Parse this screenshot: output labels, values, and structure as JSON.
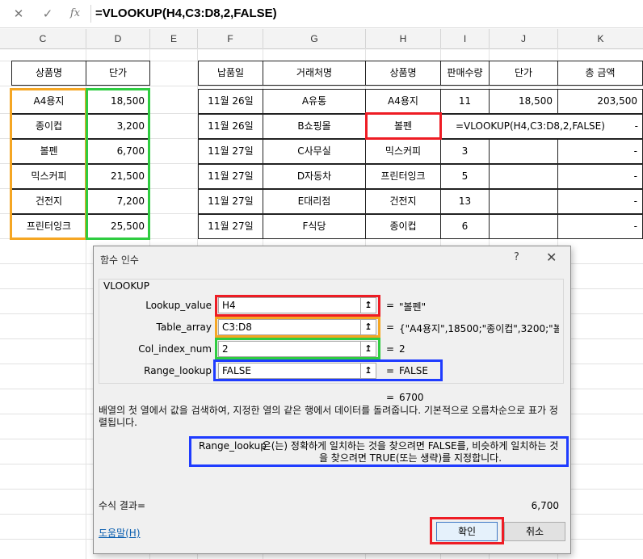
{
  "formula_bar": {
    "cancel": "✕",
    "enter": "✓",
    "fx": "fx",
    "formula": "=VLOOKUP(H4,C3:D8,2,FALSE)"
  },
  "columns": [
    "C",
    "D",
    "E",
    "F",
    "G",
    "H",
    "I",
    "J",
    "K"
  ],
  "price_table": {
    "headers": [
      "상품명",
      "단가"
    ],
    "rows": [
      [
        "A4용지",
        "18,500"
      ],
      [
        "종이컵",
        "3,200"
      ],
      [
        "볼펜",
        "6,700"
      ],
      [
        "믹스커피",
        "21,500"
      ],
      [
        "건전지",
        "7,200"
      ],
      [
        "프린터잉크",
        "25,500"
      ]
    ]
  },
  "sales_table": {
    "headers": [
      "납품일",
      "거래처명",
      "상품명",
      "판매수량",
      "단가",
      "총 금액"
    ],
    "rows": [
      [
        "11월 26일",
        "A유통",
        "A4용지",
        "11",
        "18,500",
        "203,500"
      ],
      [
        "11월 26일",
        "B쇼핑몰",
        "볼펜",
        "",
        "",
        "-"
      ],
      [
        "11월 27일",
        "C사무실",
        "믹스커피",
        "3",
        "",
        "-"
      ],
      [
        "11월 27일",
        "D자동차",
        "프린터잉크",
        "5",
        "",
        "-"
      ],
      [
        "11월 27일",
        "E대리점",
        "건전지",
        "13",
        "",
        "-"
      ],
      [
        "11월 27일",
        "F식당",
        "종이컵",
        "6",
        "",
        "-"
      ]
    ],
    "editing_formula": "=VLOOKUP(H4,C3:D8,2,FALSE)"
  },
  "dialog": {
    "title": "함수 인수",
    "help_icon": "?",
    "close_icon": "✕",
    "function_name": "VLOOKUP",
    "args": [
      {
        "label": "Lookup_value",
        "value": "H4",
        "result": "\"볼펜\""
      },
      {
        "label": "Table_array",
        "value": "C3:D8",
        "result": "{\"A4용지\",18500;\"종이컵\",3200;\"볼펜"
      },
      {
        "label": "Col_index_num",
        "value": "2",
        "result": "2"
      },
      {
        "label": "Range_lookup",
        "value": "FALSE",
        "result": "FALSE"
      }
    ],
    "equals": "=",
    "collapse_icon": "↥",
    "function_result": "6700",
    "description": "배열의 첫 열에서 값을 검색하여, 지정한 열의 같은 행에서 데이터를 돌려줍니다. 기본적으로 오름차순으로 표가 정렬됩니다.",
    "arg_description_name": "Range_lookup",
    "arg_description": "은(는) 정확하게 일치하는 것을 찾으려면 FALSE를, 비슷하게 일치하는 것을 찾으려면 TRUE(또는 생략)를 지정합니다.",
    "formula_result_label": "수식 결과=",
    "formula_result_value": "6,700",
    "help_link": "도움말(H)",
    "ok_label": "확인",
    "cancel_label": "취소"
  },
  "colors": {
    "red": "#ee1c24",
    "orange": "#f5a623",
    "green": "#2ecc40",
    "blue": "#1f3cff"
  }
}
